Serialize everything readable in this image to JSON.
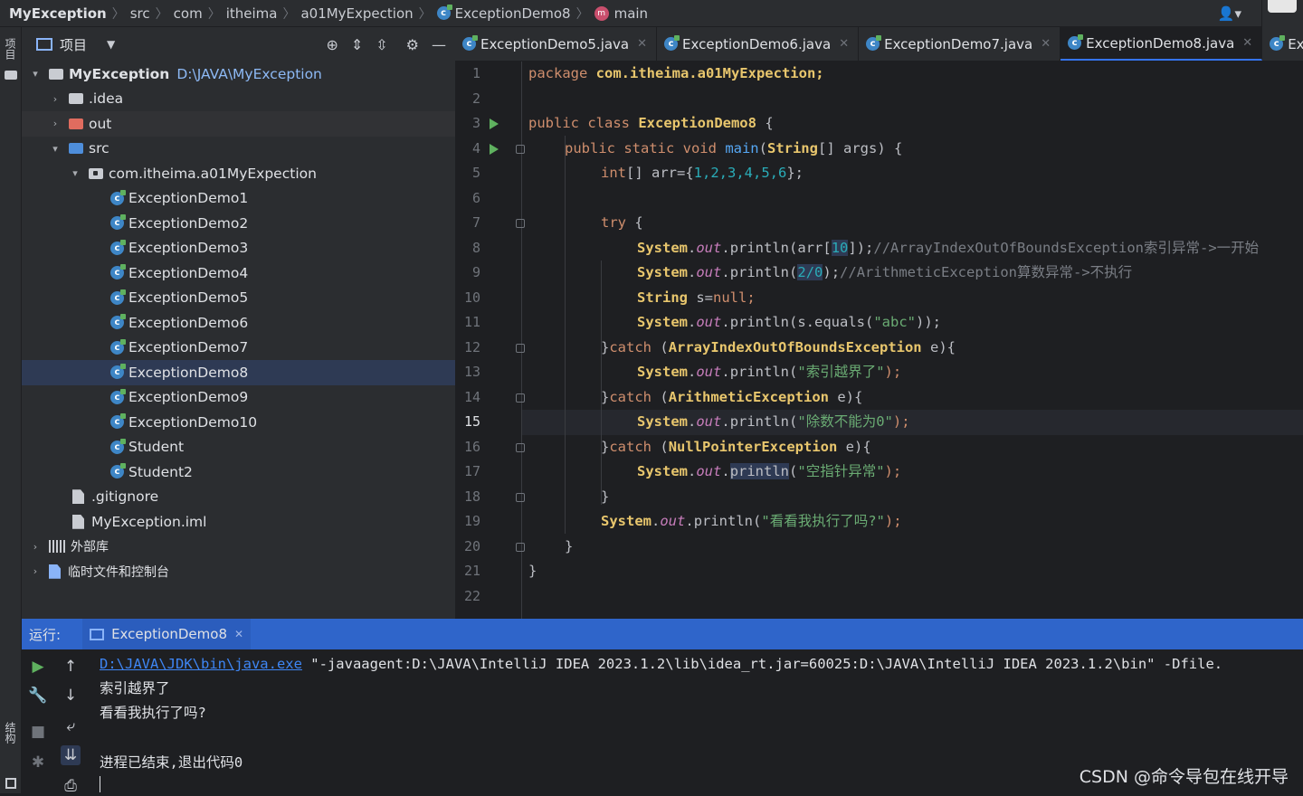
{
  "breadcrumb": {
    "items": [
      "MyException",
      "src",
      "com",
      "itheima",
      "a01MyExpection",
      "ExceptionDemo8",
      "main"
    ]
  },
  "left_strip": {
    "project_label": "项目",
    "structure_label": "结构"
  },
  "project_panel": {
    "title": "项目",
    "root": {
      "name": "MyException",
      "path": "D:\\JAVA\\MyException"
    },
    "folders": {
      "idea": ".idea",
      "out": "out",
      "src": "src",
      "package": "com.itheima.a01MyExpection"
    },
    "classes": [
      "ExceptionDemo1",
      "ExceptionDemo2",
      "ExceptionDemo3",
      "ExceptionDemo4",
      "ExceptionDemo5",
      "ExceptionDemo6",
      "ExceptionDemo7",
      "ExceptionDemo8",
      "ExceptionDemo9",
      "ExceptionDemo10",
      "Student",
      "Student2"
    ],
    "files": [
      ".gitignore",
      "MyException.iml"
    ],
    "external_libs": "外部库",
    "scratches": "临时文件和控制台"
  },
  "editor": {
    "tabs": [
      {
        "label": "ExceptionDemo5.java"
      },
      {
        "label": "ExceptionDemo6.java"
      },
      {
        "label": "ExceptionDemo7.java"
      },
      {
        "label": "ExceptionDemo8.java",
        "active": true
      },
      {
        "label": "Exce"
      }
    ],
    "line_numbers": [
      "1",
      "2",
      "3",
      "4",
      "5",
      "6",
      "7",
      "8",
      "9",
      "10",
      "11",
      "12",
      "13",
      "14",
      "15",
      "16",
      "17",
      "18",
      "19",
      "20",
      "21",
      "22"
    ],
    "current_line": 15,
    "code": {
      "l1_kw": "package ",
      "l1_pkg": "com.itheima.a01MyExpection;",
      "l3_kw": "public class ",
      "l3_cls": "ExceptionDemo8",
      "l3_rest": " {",
      "l4_kw": "public static void ",
      "l4_fn": "main",
      "l4_a": "(",
      "l4_cls": "String",
      "l4_b": "[] ",
      "l4_var": "args",
      "l4_c": ") {",
      "l5_kw": "int",
      "l5_a": "[] ",
      "l5_var": "arr",
      "l5_b": "={",
      "l5_nums": "1,2,3,4,5,6",
      "l5_c": "};",
      "l7_kw": "try",
      "l7_a": " {",
      "sys": "System",
      "dot": ".",
      "out": "out",
      "println": "println",
      "l8_a": "(",
      "l8_arr": "arr",
      "l8_b": "[",
      "l8_idx": "10",
      "l8_c": "]);",
      "l8_cm": "//ArrayIndexOutOfBoundsException索引异常->一开始",
      "l9_a": "(",
      "l9_div": "2/0",
      "l9_b": ");",
      "l9_cm": "//ArithmeticException算数异常->不执行",
      "l10_cls": "String",
      "l10_a": " s=",
      "l10_kw": "null",
      "l10_b": ";",
      "l11_a": "(s.equals(",
      "l11_str": "\"abc\"",
      "l11_b": "));",
      "l12_a": "}",
      "l12_kw": "catch",
      "l12_b": " (",
      "l12_cls": "ArrayIndexOutOfBoundsException",
      "l12_c": " e){",
      "l13_str": "\"索引越界了\"",
      "l14_cls": "ArithmeticException",
      "l15_str": "\"除数不能为0\"",
      "l16_cls": "NullPointerException",
      "l17_str": "\"空指针异常\"",
      "l18": "}",
      "l19_str": "\"看看我执行了吗?\"",
      "close": "}",
      "open_paren": "(",
      "close_stmt": ");"
    }
  },
  "run_panel": {
    "label": "运行:",
    "tab": "ExceptionDemo8",
    "console": {
      "cmd_link": "D:\\JAVA\\JDK\\bin\\java.exe",
      "cmd_rest": " \"-javaagent:D:\\JAVA\\IntelliJ IDEA 2023.1.2\\lib\\idea_rt.jar=60025:D:\\JAVA\\IntelliJ IDEA 2023.1.2\\bin\" -Dfile.",
      "out1": "索引越界了",
      "out2": "看看我执行了吗?",
      "exit": "进程已结束,退出代码0"
    }
  },
  "watermark": "CSDN @命令导包在线开导"
}
